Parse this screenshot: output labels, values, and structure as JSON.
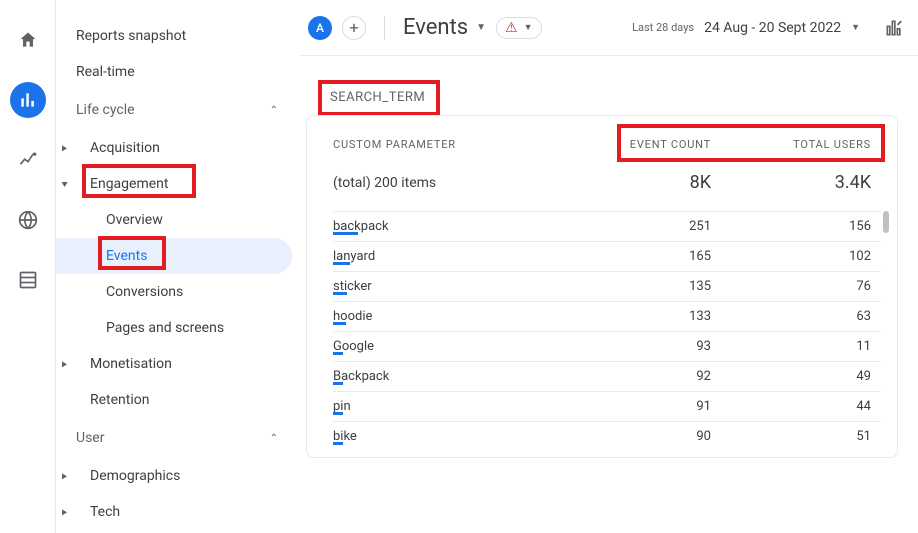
{
  "rail": {
    "items": [
      {
        "name": "home-icon"
      },
      {
        "name": "reports-icon"
      },
      {
        "name": "explore-icon"
      },
      {
        "name": "advertising-icon"
      },
      {
        "name": "configure-icon"
      }
    ]
  },
  "sidebar": {
    "reports_snapshot": "Reports snapshot",
    "realtime": "Real-time",
    "sections": [
      {
        "label": "Life cycle",
        "items": [
          {
            "label": "Acquisition",
            "children": []
          },
          {
            "label": "Engagement",
            "children": [
              {
                "label": "Overview"
              },
              {
                "label": "Events"
              },
              {
                "label": "Conversions"
              },
              {
                "label": "Pages and screens"
              }
            ]
          },
          {
            "label": "Monetisation",
            "children": []
          },
          {
            "label": "Retention"
          }
        ]
      },
      {
        "label": "User",
        "items": [
          {
            "label": "Demographics"
          },
          {
            "label": "Tech"
          }
        ]
      }
    ]
  },
  "topbar": {
    "account_letter": "A",
    "add_icon": "+",
    "events_label": "Events",
    "date_prefix": "Last 28 days",
    "date_range": "24 Aug - 20 Sept 2022"
  },
  "card": {
    "title": "SEARCH_TERM",
    "headers": {
      "param": "CUSTOM PARAMETER",
      "count": "EVENT COUNT",
      "users": "TOTAL USERS"
    },
    "totals": {
      "label": "(total) 200 items",
      "count": "8K",
      "users": "3.4K"
    },
    "rows": [
      {
        "label": "backpack",
        "count": "251",
        "users": "156",
        "bar": 25
      },
      {
        "label": "lanyard",
        "count": "165",
        "users": "102",
        "bar": 17
      },
      {
        "label": "sticker",
        "count": "135",
        "users": "76",
        "bar": 14
      },
      {
        "label": "hoodie",
        "count": "133",
        "users": "63",
        "bar": 13
      },
      {
        "label": "Google",
        "count": "93",
        "users": "11",
        "bar": 10
      },
      {
        "label": "Backpack",
        "count": "92",
        "users": "49",
        "bar": 10
      },
      {
        "label": "pin",
        "count": "91",
        "users": "44",
        "bar": 10
      },
      {
        "label": "bike",
        "count": "90",
        "users": "51",
        "bar": 10
      }
    ]
  },
  "chart_data": {
    "type": "table",
    "title": "SEARCH_TERM",
    "columns": [
      "CUSTOM PARAMETER",
      "EVENT COUNT",
      "TOTAL USERS"
    ],
    "totals": {
      "label": "(total) 200 items",
      "event_count": 8000,
      "total_users": 3400
    },
    "rows": [
      {
        "custom_parameter": "backpack",
        "event_count": 251,
        "total_users": 156
      },
      {
        "custom_parameter": "lanyard",
        "event_count": 165,
        "total_users": 102
      },
      {
        "custom_parameter": "sticker",
        "event_count": 135,
        "total_users": 76
      },
      {
        "custom_parameter": "hoodie",
        "event_count": 133,
        "total_users": 63
      },
      {
        "custom_parameter": "Google",
        "event_count": 93,
        "total_users": 11
      },
      {
        "custom_parameter": "Backpack",
        "event_count": 92,
        "total_users": 49
      },
      {
        "custom_parameter": "pin",
        "event_count": 91,
        "total_users": 44
      },
      {
        "custom_parameter": "bike",
        "event_count": 90,
        "total_users": 51
      }
    ]
  }
}
